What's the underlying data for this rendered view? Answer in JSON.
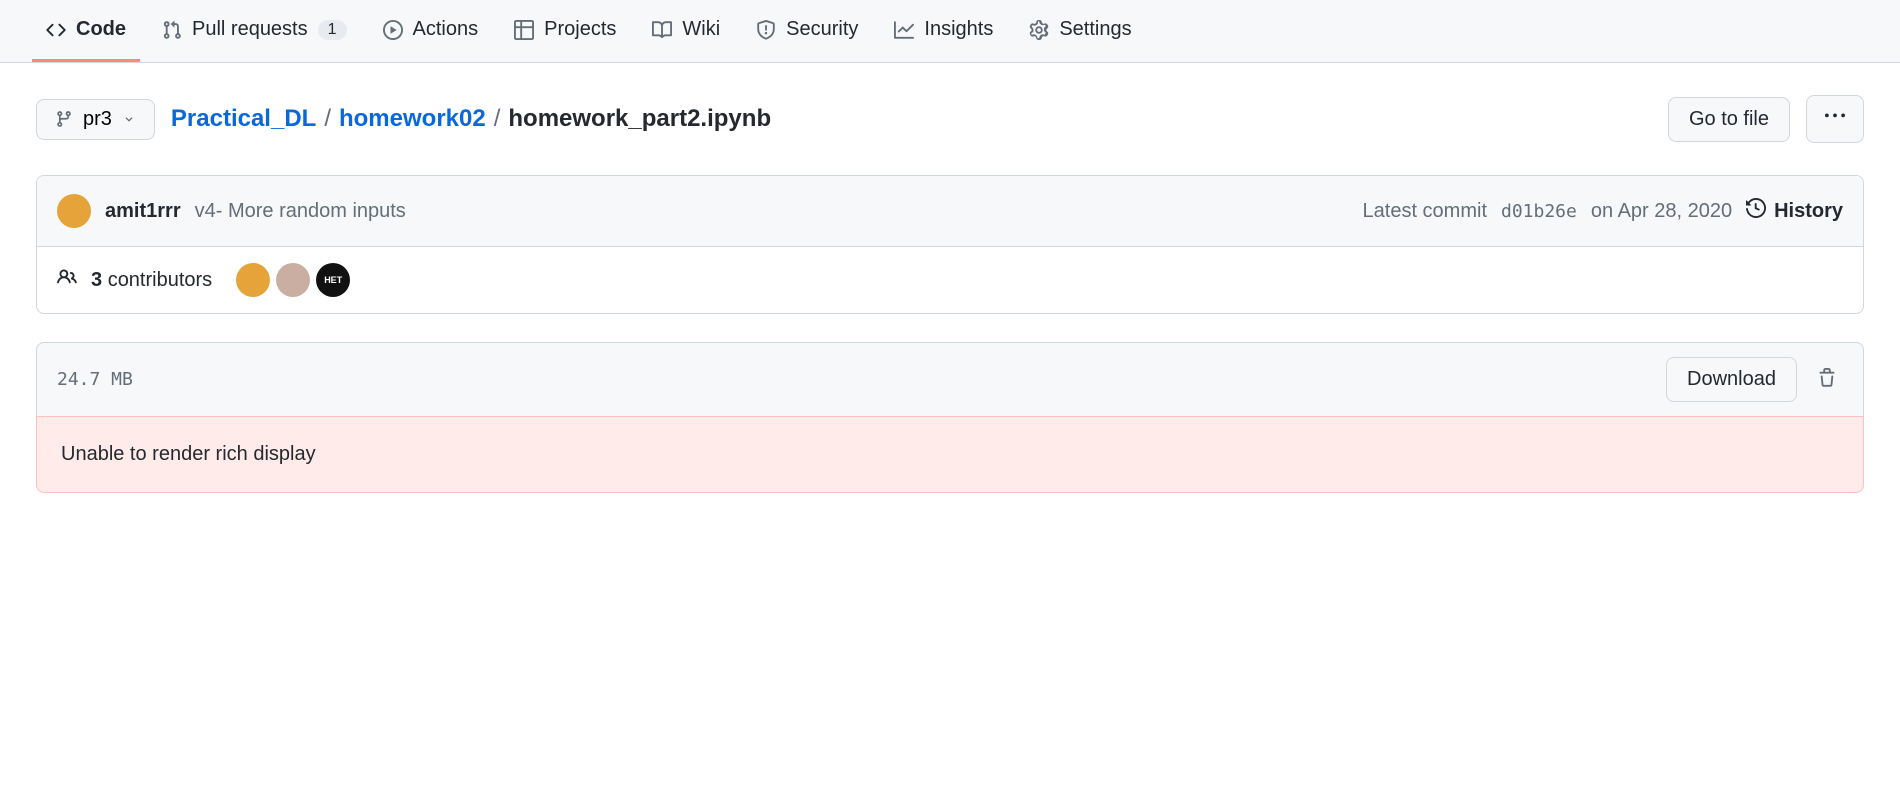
{
  "nav": {
    "items": [
      {
        "label": "Code",
        "icon": "code",
        "selected": true
      },
      {
        "label": "Pull requests",
        "icon": "pr",
        "count": "1"
      },
      {
        "label": "Actions",
        "icon": "play"
      },
      {
        "label": "Projects",
        "icon": "table"
      },
      {
        "label": "Wiki",
        "icon": "book"
      },
      {
        "label": "Security",
        "icon": "shield"
      },
      {
        "label": "Insights",
        "icon": "graph"
      },
      {
        "label": "Settings",
        "icon": "gear"
      }
    ]
  },
  "branch": {
    "name": "pr3"
  },
  "breadcrumbs": {
    "repo": "Practical_DL",
    "folder": "homework02",
    "file": "homework_part2.ipynb"
  },
  "actions": {
    "go_to_file": "Go to file",
    "download": "Download"
  },
  "commit": {
    "author": "amit1rrr",
    "message": "v4- More random inputs",
    "latest_label": "Latest commit",
    "hash": "d01b26e",
    "date_prefix": "on",
    "date": "Apr 28, 2020",
    "history_label": "History"
  },
  "contributors": {
    "count": "3",
    "label": "contributors",
    "avatar3_text": "HET"
  },
  "file": {
    "size": "24.7 MB",
    "error": "Unable to render rich display"
  }
}
